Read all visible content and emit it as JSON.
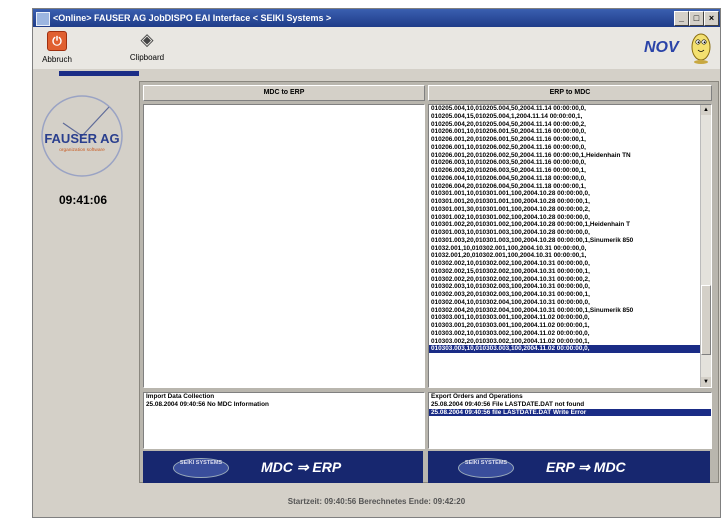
{
  "window": {
    "title": "<Online> FAUSER AG JobDISPO EAI Interface < SEIKI Systems >",
    "minimize_label": "_",
    "maximize_label": "□",
    "close_label": "×"
  },
  "toolbar": {
    "abbruch_label": "Abbruch",
    "clipboard_label": "Clipboard"
  },
  "logo": {
    "text": "NOV"
  },
  "clock": {
    "time": "09:41:06",
    "logo_text": "FAUSER AG",
    "logo_tagline": "organization software"
  },
  "mdc_to_erp": {
    "header": "MDC to ERP",
    "lines": []
  },
  "erp_to_mdc": {
    "header": "ERP to MDC",
    "lines": [
      "010205.004,10,010205.004,50,2004.11.14 00:00:00,0,",
      "010205.004,15,010205.004,1,2004.11.14 00:00:00,1,",
      "010205.004,20,010205.004,50,2004.11.14 00:00:00,2,",
      "010206.001,10,010206.001,50,2004.11.16 00:00:00,0,",
      "010206.001,20,010206.001,50,2004.11.16 00:00:00,1,",
      "010206.001,10,010206.002,50,2004.11.16 00:00:00,0,",
      "010206.001,20,010206.002,50,2004.11.16 00:00:00,1,Heidenhain TN",
      "010206.003,10,010206.003,50,2004.11.16 00:00:00,0,",
      "010206.003,20,010206.003,50,2004.11.16 00:00:00,1,",
      "010206.004,10,010206.004,50,2004.11.18 00:00:00,0,",
      "010206.004,20,010206.004,50,2004.11.18 00:00:00,1,",
      "010301.001,10,010301.001,100,2004.10.28 00:00:00,0,",
      "010301.001,20,010301.001,100,2004.10.28 00:00:00,1,",
      "010301.001,30,010301.001,100,2004.10.28 00:00:00,2,",
      "010301.002,10,010301.002,100,2004.10.28 00:00:00,0,",
      "010301.002,20,010301.002,100,2004.10.28 00:00:00,1,Heidenhain T",
      "010301.003,10,010301.003,100,2004.10.28 00:00:00,0,",
      "010301.003,20,010301.003,100,2004.10.28 00:00:00,1,Sinumerik 850",
      "01032.001,10,010302.001,100,2004.10.31 00:00:00,0,",
      "01032.001,20,010302.001,100,2004.10.31 00:00:00,1,",
      "010302.002,10,010302.002,100,2004.10.31 00:00:00,0,",
      "010302.002,15,010302.002,100,2004.10.31 00:00:00,1,",
      "010302.002,20,010302.002,100,2004.10.31 00:00:00,2,",
      "010302.003,10,010302.003,100,2004.10.31 00:00:00,0,",
      "010302.003,20,010302.003,100,2004.10.31 00:00:00,1,",
      "010302.004,10,010302.004,100,2004.10.31 00:00:00,0,",
      "010302.004,20,010302.004,100,2004.10.31 00:00:00,1,Sinumerik 850",
      "010303.001,10,010303.001,100,2004.11.02 00:00:00,0,",
      "010303.001,20,010303.001,100,2004.11.02 00:00:00,1,",
      "010303.002,10,010303.002,100,2004.11.02 00:00:00,0,",
      "010303.002,20,010303.002,100,2004.11.02 00:00:00,1,",
      "010303.003,10,010303.003,100,2004.11.02 00:00:00,0,"
    ],
    "selected_index": 31
  },
  "import_log": {
    "title": "Import Data Collection",
    "lines": [
      "25.08.2004 09:40:56 No MDC Information"
    ]
  },
  "export_log": {
    "title": "Export Orders and Operations",
    "lines": [
      "25.08.2004 09:40:56 File LASTDATE.DAT not found",
      "25.08.2004 09:40:56 file LASTDATE.DAT Write Error"
    ],
    "selected_index": 1
  },
  "banners": {
    "left": {
      "seiki": "SEIKI SYSTEMS",
      "label": "MDC ⇒ ERP"
    },
    "right": {
      "seiki": "SEIKI SYSTEMS",
      "label": "ERP ⇒ MDC"
    }
  },
  "status": "Startzeit: 09:40:56  Berechnetes Ende: 09:42:20"
}
